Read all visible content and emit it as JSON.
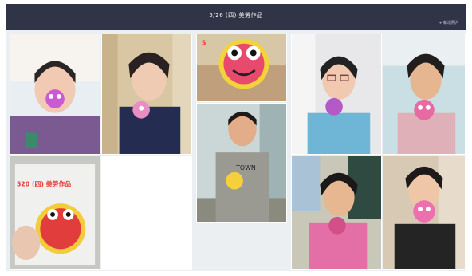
{
  "header": {
    "title": "5/26 (四) 美勞作品",
    "action_label": "+ 新增照片"
  },
  "photos": [
    {
      "name": "photo-girl-purple-shirt"
    },
    {
      "name": "photo-girl-navy-shirt"
    },
    {
      "name": "photo-crab-craft-closeup"
    },
    {
      "name": "photo-girl-glasses-blue"
    },
    {
      "name": "photo-girl-pink-shirt-1"
    },
    {
      "name": "photo-tablet-crab-craft",
      "overlay_text": "520 (四) 美勞作品"
    },
    {
      "name": "photo-boy-grey-shirt"
    },
    {
      "name": "photo-girl-pink-shirt-2"
    },
    {
      "name": "photo-girl-black-shirt"
    }
  ],
  "colors": {
    "header_bg": "#2f3547",
    "board_bg": "#eceff2"
  }
}
